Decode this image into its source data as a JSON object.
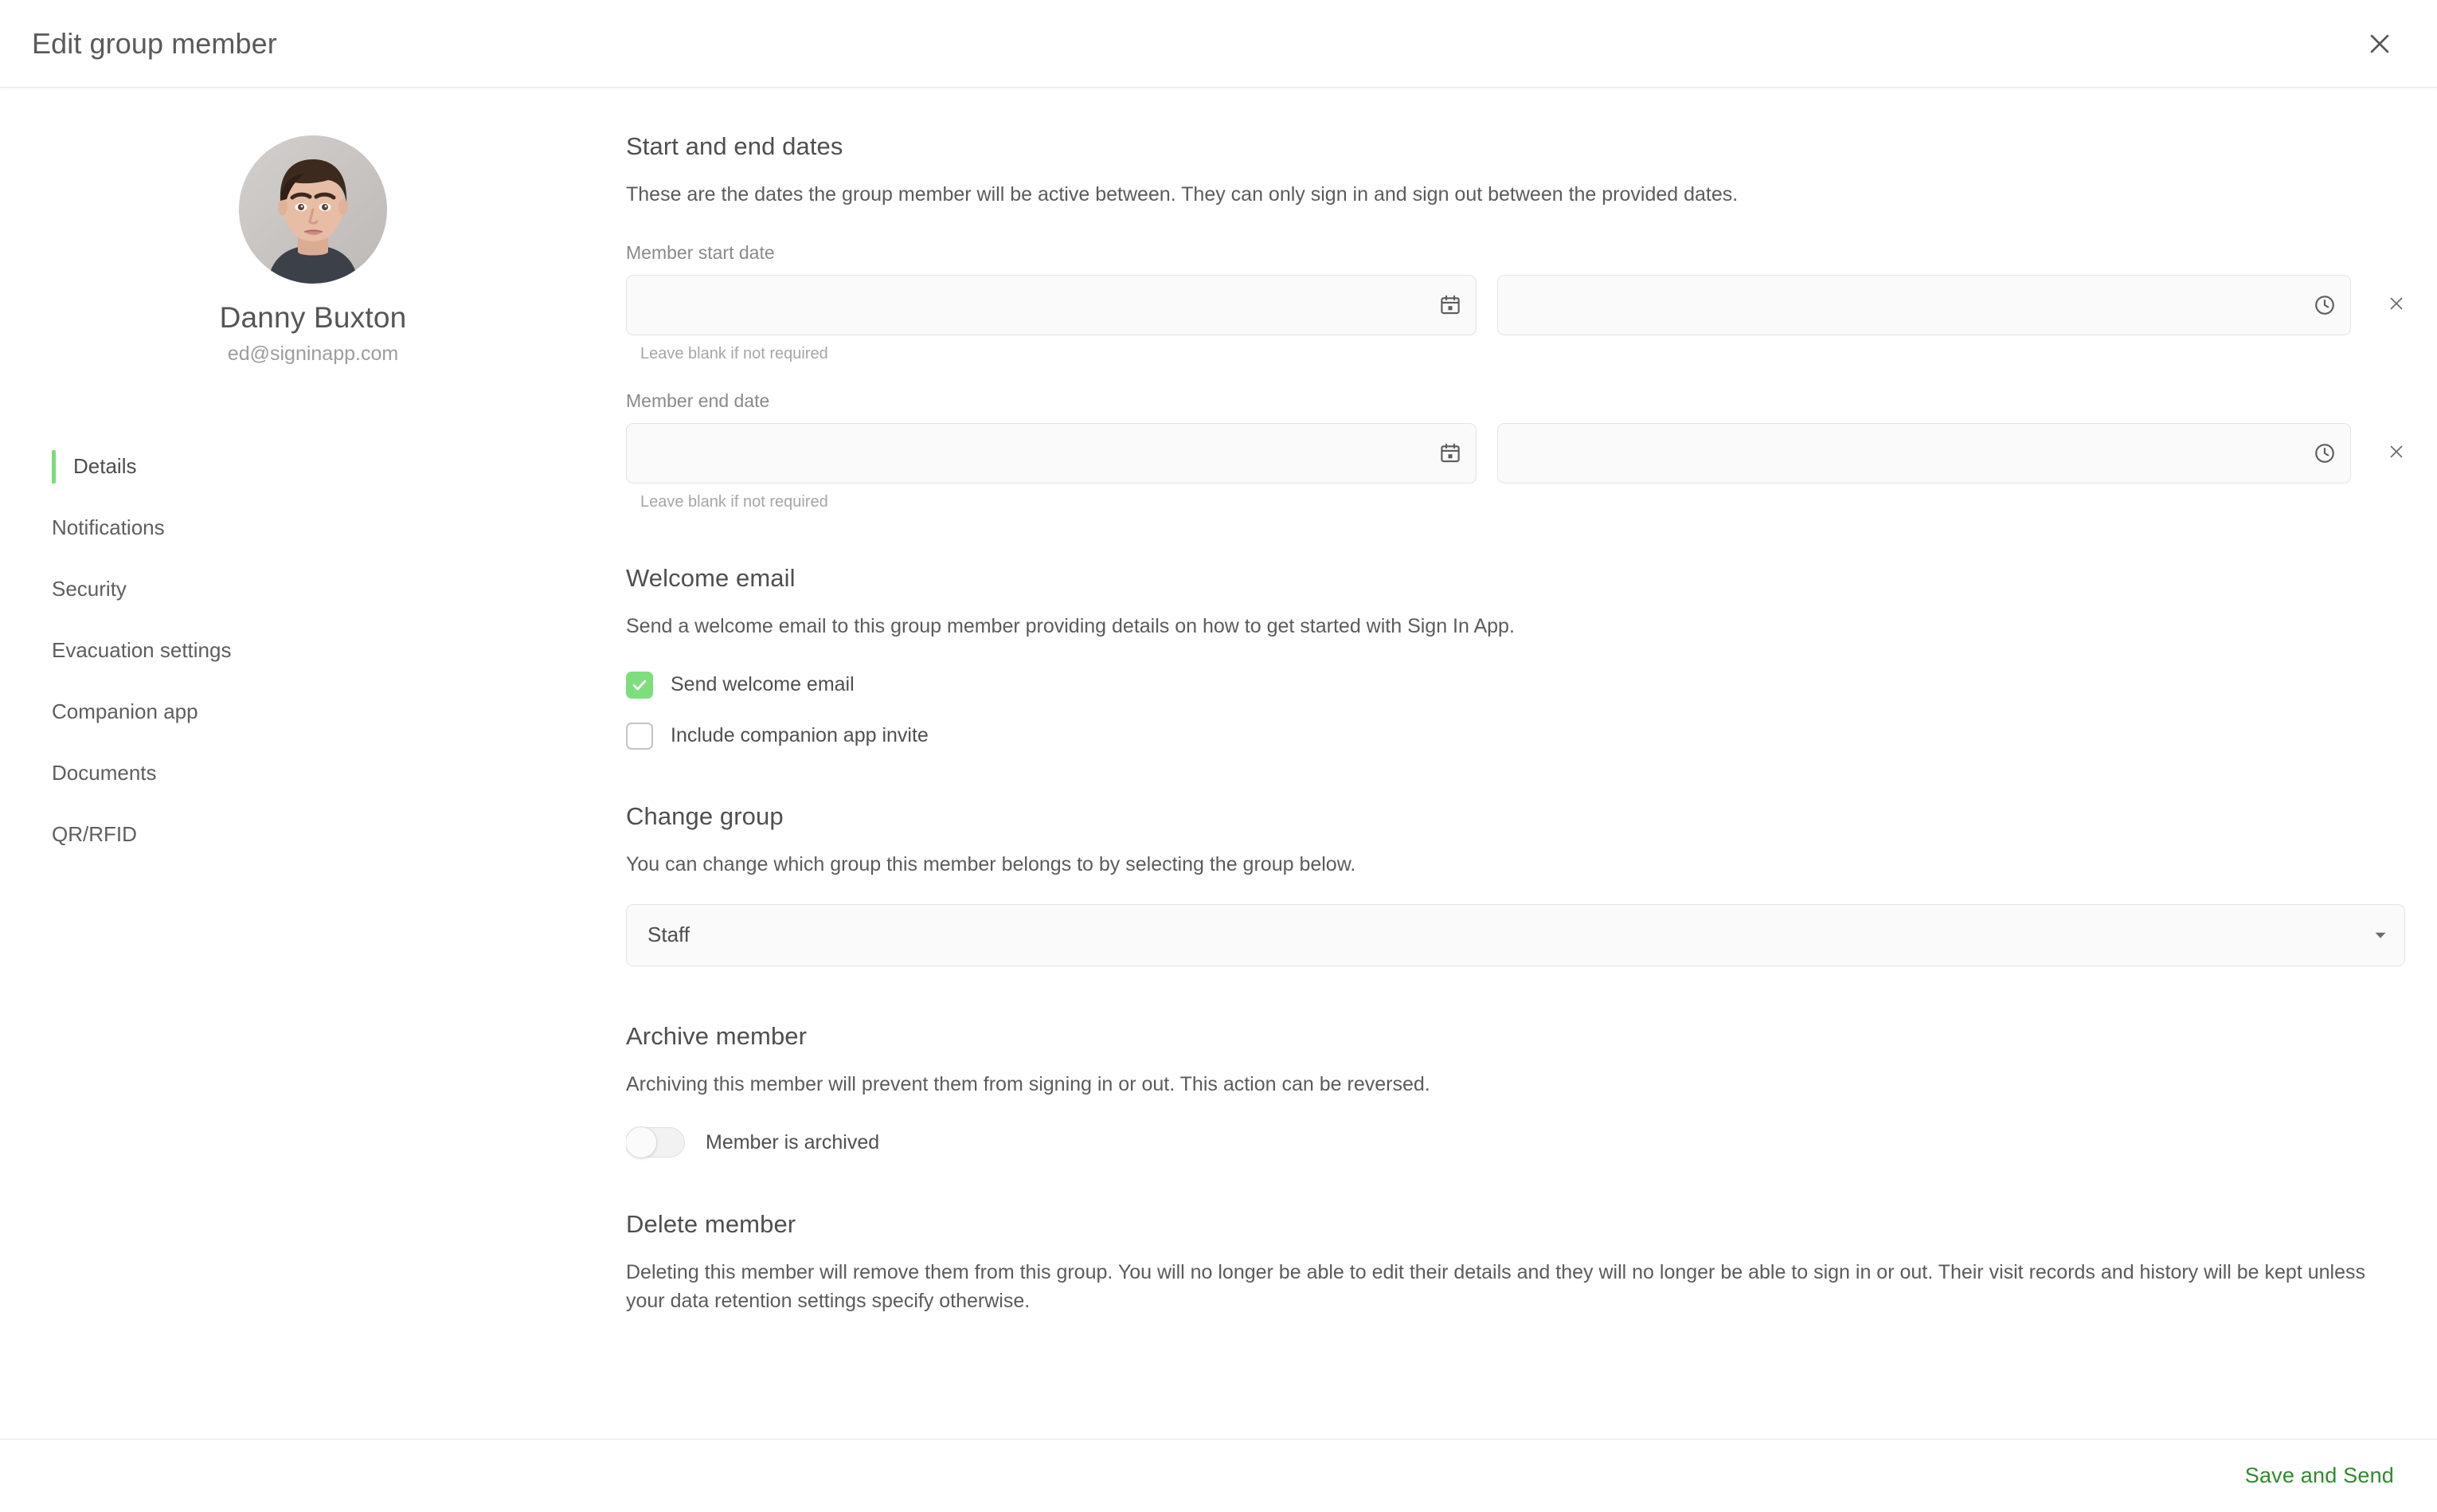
{
  "header": {
    "title": "Edit group member",
    "close_label": "Close"
  },
  "profile": {
    "name": "Danny Buxton",
    "email": "ed@signinapp.com"
  },
  "sidebar": {
    "items": [
      {
        "label": "Details",
        "active": true
      },
      {
        "label": "Notifications",
        "active": false
      },
      {
        "label": "Security",
        "active": false
      },
      {
        "label": "Evacuation settings",
        "active": false
      },
      {
        "label": "Companion app",
        "active": false
      },
      {
        "label": "Documents",
        "active": false
      },
      {
        "label": "QR/RFID",
        "active": false
      }
    ]
  },
  "dates_section": {
    "title": "Start and end dates",
    "description": "These are the dates the group member will be active between. They can only sign in and sign out between the provided dates.",
    "start": {
      "label": "Member start date",
      "date_value": "",
      "date_placeholder": "",
      "time_value": "",
      "time_placeholder": "",
      "hint": "Leave blank if not required"
    },
    "end": {
      "label": "Member end date",
      "date_value": "",
      "date_placeholder": "",
      "time_value": "",
      "time_placeholder": "",
      "hint": "Leave blank if not required"
    }
  },
  "welcome_section": {
    "title": "Welcome email",
    "description": "Send a welcome email to this group member providing details on how to get started with Sign In App.",
    "send_welcome_email": {
      "label": "Send welcome email",
      "checked": true
    },
    "include_companion_invite": {
      "label": "Include companion app invite",
      "checked": false
    }
  },
  "change_group_section": {
    "title": "Change group",
    "description": "You can change which group this member belongs to by selecting the group below.",
    "selected_group": "Staff"
  },
  "archive_section": {
    "title": "Archive member",
    "description": "Archiving this member will prevent them from signing in or out. This action can be reversed.",
    "toggle_label": "Member is archived",
    "toggle_on": false
  },
  "delete_section": {
    "title": "Delete member",
    "description": "Deleting this member will remove them from this group. You will no longer be able to edit their details and they will no longer be able to sign in or out. Their visit records and history will be kept unless your data retention settings specify otherwise."
  },
  "footer": {
    "save_label": "Save and Send"
  },
  "colors": {
    "accent_green": "#77dd77",
    "save_green": "#2e8b2e",
    "text_primary": "#4f4f4f",
    "text_muted": "#9d9d9d",
    "field_bg": "#fafafa",
    "field_border": "#e4e4e4"
  }
}
